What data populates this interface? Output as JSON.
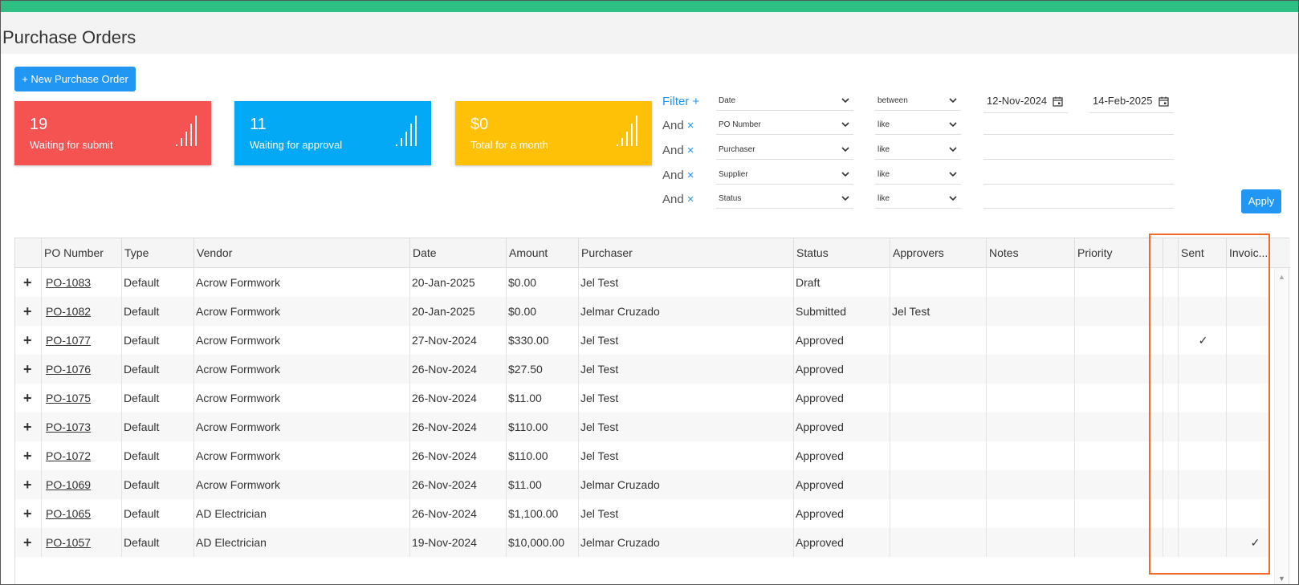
{
  "page": {
    "title": "Purchase Orders"
  },
  "toolbar": {
    "new_label": "+ New Purchase Order",
    "apply_label": "Apply"
  },
  "cards": [
    {
      "count": "19",
      "label": "Waiting for submit",
      "color": "#f55252"
    },
    {
      "count": "11",
      "label": "Waiting for approval",
      "color": "#03a9f4"
    },
    {
      "count": "$0",
      "label": "Total for a month",
      "color": "#ffc107"
    }
  ],
  "filters": {
    "head": "Filter",
    "head_icon": "+",
    "and_label": "And",
    "remove_icon": "×",
    "rows": [
      {
        "field": "Date",
        "op": "between",
        "from": "12-Nov-2024",
        "to": "14-Feb-2025"
      },
      {
        "field": "PO Number",
        "op": "like"
      },
      {
        "field": "Purchaser",
        "op": "like"
      },
      {
        "field": "Supplier",
        "op": "like"
      },
      {
        "field": "Status",
        "op": "like"
      }
    ]
  },
  "table": {
    "headers": [
      "PO Number",
      "Type",
      "Vendor",
      "Date",
      "Amount",
      "Purchaser",
      "Status",
      "Approvers",
      "Notes",
      "Priority",
      "Sent",
      "Invoic..."
    ],
    "rows": [
      {
        "po": "PO-1083",
        "type": "Default",
        "vendor": "Acrow Formwork",
        "date": "20-Jan-2025",
        "amount": "$0.00",
        "purchaser": "Jel Test",
        "status": "Draft",
        "approvers": "",
        "sent": "",
        "invoiced": ""
      },
      {
        "po": "PO-1082",
        "type": "Default",
        "vendor": "Acrow Formwork",
        "date": "20-Jan-2025",
        "amount": "$0.00",
        "purchaser": "Jelmar Cruzado",
        "status": "Submitted",
        "approvers": "Jel Test",
        "sent": "",
        "invoiced": ""
      },
      {
        "po": "PO-1077",
        "type": "Default",
        "vendor": "Acrow Formwork",
        "date": "27-Nov-2024",
        "amount": "$330.00",
        "purchaser": "Jel Test",
        "status": "Approved",
        "approvers": "",
        "sent": "✓",
        "invoiced": ""
      },
      {
        "po": "PO-1076",
        "type": "Default",
        "vendor": "Acrow Formwork",
        "date": "26-Nov-2024",
        "amount": "$27.50",
        "purchaser": "Jel Test",
        "status": "Approved",
        "approvers": "",
        "sent": "",
        "invoiced": ""
      },
      {
        "po": "PO-1075",
        "type": "Default",
        "vendor": "Acrow Formwork",
        "date": "26-Nov-2024",
        "amount": "$11.00",
        "purchaser": "Jel Test",
        "status": "Approved",
        "approvers": "",
        "sent": "",
        "invoiced": ""
      },
      {
        "po": "PO-1073",
        "type": "Default",
        "vendor": "Acrow Formwork",
        "date": "26-Nov-2024",
        "amount": "$110.00",
        "purchaser": "Jel Test",
        "status": "Approved",
        "approvers": "",
        "sent": "",
        "invoiced": ""
      },
      {
        "po": "PO-1072",
        "type": "Default",
        "vendor": "Acrow Formwork",
        "date": "26-Nov-2024",
        "amount": "$110.00",
        "purchaser": "Jel Test",
        "status": "Approved",
        "approvers": "",
        "sent": "",
        "invoiced": ""
      },
      {
        "po": "PO-1069",
        "type": "Default",
        "vendor": "Acrow Formwork",
        "date": "26-Nov-2024",
        "amount": "$11.00",
        "purchaser": "Jelmar Cruzado",
        "status": "Approved",
        "approvers": "",
        "sent": "",
        "invoiced": ""
      },
      {
        "po": "PO-1065",
        "type": "Default",
        "vendor": "AD Electrician",
        "date": "26-Nov-2024",
        "amount": "$1,100.00",
        "purchaser": "Jel Test",
        "status": "Approved",
        "approvers": "",
        "sent": "",
        "invoiced": ""
      },
      {
        "po": "PO-1057",
        "type": "Default",
        "vendor": "AD Electrician",
        "date": "19-Nov-2024",
        "amount": "$10,000.00",
        "purchaser": "Jelmar Cruzado",
        "status": "Approved",
        "approvers": "",
        "sent": "",
        "invoiced": "✓"
      }
    ]
  },
  "icons": {
    "expand": "plus-icon",
    "chevron": "chevron-down-icon",
    "calendar": "calendar-icon",
    "stats": "bar-chart-icon"
  },
  "accent": "#2196f3",
  "topbar_color": "#2ebf85",
  "highlight_color": "#f06a2a"
}
